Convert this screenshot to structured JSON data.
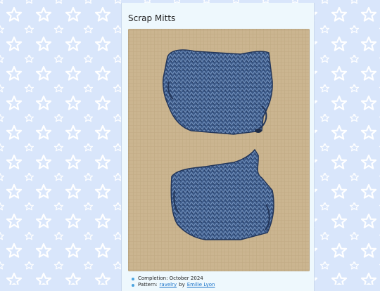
{
  "page": {
    "background_color": "#d9e6fb",
    "star_color": "#ffffff",
    "panel_color": "#eef8fd"
  },
  "post": {
    "title": "Scrap Mitts",
    "image": {
      "description_icon": "knitted-mitts-photo",
      "colors": {
        "yarn": "#3e5e8e",
        "background_cloth": "#c9b48f"
      }
    },
    "details": [
      {
        "label": "Completion: October 2024"
      },
      {
        "label": "Pattern:",
        "link_text": "ravelry",
        "middle": "by",
        "author_link": "Emilie Lyon"
      }
    ]
  }
}
